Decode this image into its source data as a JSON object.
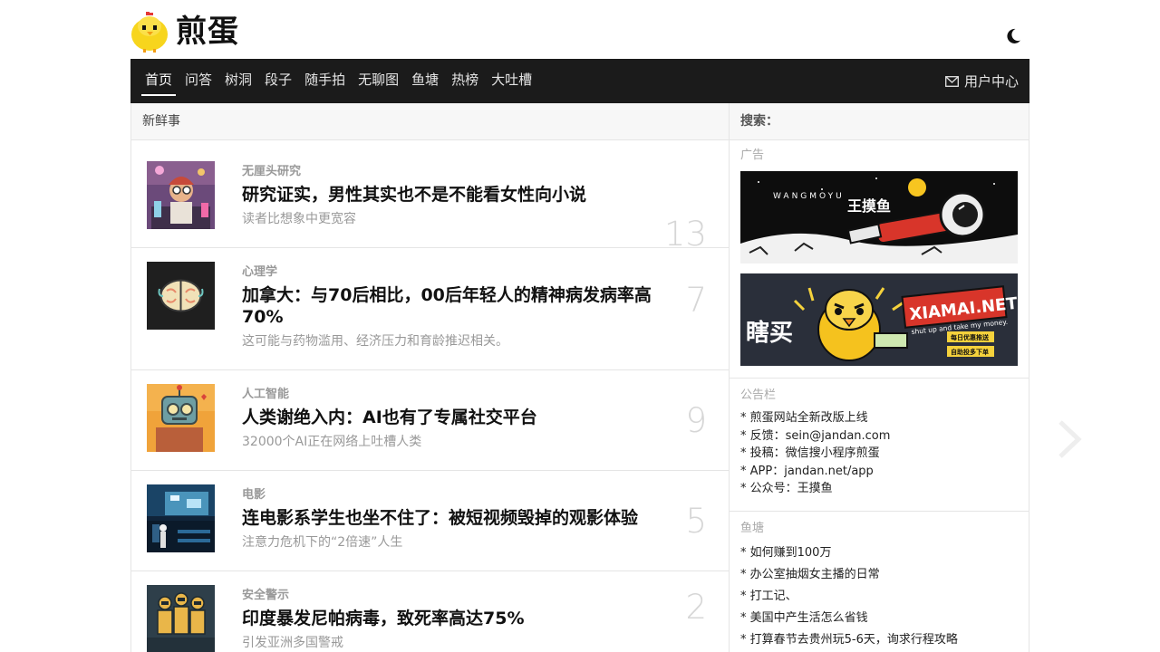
{
  "brand": {
    "logo_text": "煎蛋"
  },
  "nav": {
    "items": [
      "首页",
      "问答",
      "树洞",
      "段子",
      "随手拍",
      "无聊图",
      "鱼塘",
      "热榜",
      "大吐槽"
    ],
    "user_center": "用户中心"
  },
  "main": {
    "section_title": "新鲜事",
    "posts": [
      {
        "category": "无厘头研究",
        "title": "研究证实，男性其实也不是不能看女性向小说",
        "subtitle": "读者比想象中更宽容",
        "count": "13"
      },
      {
        "category": "心理学",
        "title": "加拿大：与70后相比，00后年轻人的精神病发病率高70%",
        "subtitle": "这可能与药物滥用、经济压力和育龄推迟相关。",
        "count": "7"
      },
      {
        "category": "人工智能",
        "title": "人类谢绝入内：AI也有了专属社交平台",
        "subtitle": "32000个AI正在网络上吐槽人类",
        "count": "9"
      },
      {
        "category": "电影",
        "title": "连电影系学生也坐不住了：被短视频毁掉的观影体验",
        "subtitle": "注意力危机下的“2倍速”人生",
        "count": "5"
      },
      {
        "category": "安全警示",
        "title": "印度暴发尼帕病毒，致死率高达75%",
        "subtitle": "引发亚洲多国警戒",
        "count": "2"
      }
    ]
  },
  "sidebar": {
    "search_label": "搜索：",
    "ad_label": "广告",
    "ad1": {
      "brand_en": "WANGMOYU",
      "brand_cn": "王摸鱼"
    },
    "ad2": {
      "brand_cn": "瞎买",
      "brand_en": "XIAMAI.NET",
      "slogan": "shut up and take my money.",
      "tag1": "每日优惠推送",
      "tag2": "自助投多下单"
    },
    "notice_label": "公告栏",
    "notices": [
      "* 煎蛋网站全新改版上线",
      "* 反馈：sein@jandan.com",
      "* 投稿：微信搜小程序煎蛋",
      "* APP：jandan.net/app",
      "* 公众号：王摸鱼"
    ],
    "pond_label": "鱼塘",
    "pond_items": [
      "* 如何赚到100万",
      "* 办公室抽烟女主播的日常",
      "* 打工记、",
      "* 美国中产生活怎么省钱",
      "* 打算春节去贵州玩5-6天，询求行程攻略"
    ]
  },
  "colors": {
    "nav_bg": "#1b1b1b",
    "chick_yellow": "#f7d51d",
    "count_gray": "#d6d6d6"
  }
}
